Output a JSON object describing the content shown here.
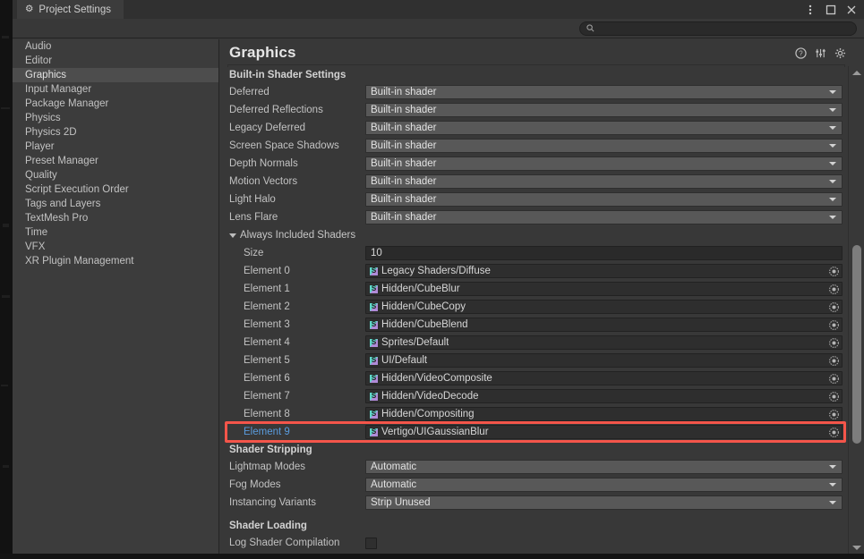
{
  "window": {
    "tab_label": "Project Settings",
    "tab_icon": "gear-icon",
    "controls": [
      {
        "name": "more-options-icon",
        "glyph": "kebab"
      },
      {
        "name": "maximize-icon",
        "glyph": "square"
      },
      {
        "name": "close-icon",
        "glyph": "x"
      }
    ]
  },
  "search": {
    "placeholder": "",
    "value": "",
    "icon": "search-icon"
  },
  "sidebar": {
    "items": [
      {
        "label": "Audio",
        "selected": false
      },
      {
        "label": "Editor",
        "selected": false
      },
      {
        "label": "Graphics",
        "selected": true
      },
      {
        "label": "Input Manager",
        "selected": false
      },
      {
        "label": "Package Manager",
        "selected": false
      },
      {
        "label": "Physics",
        "selected": false
      },
      {
        "label": "Physics 2D",
        "selected": false
      },
      {
        "label": "Player",
        "selected": false
      },
      {
        "label": "Preset Manager",
        "selected": false
      },
      {
        "label": "Quality",
        "selected": false
      },
      {
        "label": "Script Execution Order",
        "selected": false
      },
      {
        "label": "Tags and Layers",
        "selected": false
      },
      {
        "label": "TextMesh Pro",
        "selected": false
      },
      {
        "label": "Time",
        "selected": false
      },
      {
        "label": "VFX",
        "selected": false
      },
      {
        "label": "XR Plugin Management",
        "selected": false
      }
    ]
  },
  "main": {
    "title": "Graphics",
    "header_icons": [
      {
        "name": "help-icon"
      },
      {
        "name": "preset-icon"
      },
      {
        "name": "settings-gear-icon"
      }
    ],
    "builtin_shader_settings": {
      "heading": "Built-in Shader Settings",
      "rows": [
        {
          "label": "Deferred",
          "value": "Built-in shader"
        },
        {
          "label": "Deferred Reflections",
          "value": "Built-in shader"
        },
        {
          "label": "Legacy Deferred",
          "value": "Built-in shader"
        },
        {
          "label": "Screen Space Shadows",
          "value": "Built-in shader"
        },
        {
          "label": "Depth Normals",
          "value": "Built-in shader"
        },
        {
          "label": "Motion Vectors",
          "value": "Built-in shader"
        },
        {
          "label": "Light Halo",
          "value": "Built-in shader"
        },
        {
          "label": "Lens Flare",
          "value": "Built-in shader"
        }
      ]
    },
    "always_included_shaders": {
      "foldout_label": "Always Included Shaders",
      "expanded": true,
      "size_label": "Size",
      "size_value": "10",
      "elements": [
        {
          "label": "Element 0",
          "value": "Legacy Shaders/Diffuse",
          "highlighted": false
        },
        {
          "label": "Element 1",
          "value": "Hidden/CubeBlur",
          "highlighted": false
        },
        {
          "label": "Element 2",
          "value": "Hidden/CubeCopy",
          "highlighted": false
        },
        {
          "label": "Element 3",
          "value": "Hidden/CubeBlend",
          "highlighted": false
        },
        {
          "label": "Element 4",
          "value": "Sprites/Default",
          "highlighted": false
        },
        {
          "label": "Element 5",
          "value": "UI/Default",
          "highlighted": false
        },
        {
          "label": "Element 6",
          "value": "Hidden/VideoComposite",
          "highlighted": false
        },
        {
          "label": "Element 7",
          "value": "Hidden/VideoDecode",
          "highlighted": false
        },
        {
          "label": "Element 8",
          "value": "Hidden/Compositing",
          "highlighted": false
        },
        {
          "label": "Element 9",
          "value": "Vertigo/UIGaussianBlur",
          "highlighted": true
        }
      ],
      "shader_icon_letter": "S"
    },
    "shader_stripping": {
      "heading": "Shader Stripping",
      "rows": [
        {
          "label": "Lightmap Modes",
          "value": "Automatic"
        },
        {
          "label": "Fog Modes",
          "value": "Automatic"
        },
        {
          "label": "Instancing Variants",
          "value": "Strip Unused"
        }
      ]
    },
    "shader_loading": {
      "heading": "Shader Loading",
      "rows": [
        {
          "label": "Log Shader Compilation",
          "checked": false
        }
      ]
    }
  },
  "annotation": {
    "color": "#f4554a",
    "target": "Element 9"
  },
  "scrollbar": {
    "orientation": "vertical",
    "up_arrow": "scroll-up-arrow",
    "down_arrow": "scroll-down-arrow"
  }
}
